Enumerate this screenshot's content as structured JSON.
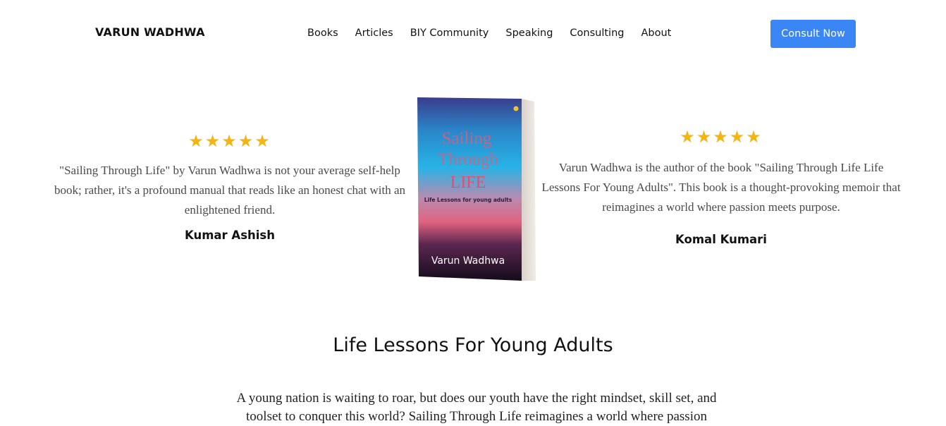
{
  "header": {
    "brand": "VARUN WADHWA",
    "nav": [
      "Books",
      "Articles",
      "BIY Community",
      "Speaking",
      "Consulting",
      "About"
    ],
    "cta_label": "Consult Now"
  },
  "reviews": [
    {
      "stars": "★★★★★",
      "rating": 5,
      "quote": "\"Sailing Through Life\" by Varun Wadhwa is not your average self-help book; rather, it's a profound manual that reads like an honest chat with an enlightened friend.",
      "name": "Kumar Ashish"
    },
    {
      "stars": "★★★★★",
      "rating": 5,
      "quote": "Varun Wadhwa is the author of the book \"Sailing Through Life Life Lessons For Young Adults\". This book is a thought-provoking memoir that reimagines a world where passion meets purpose.",
      "name": "Komal Kumari"
    }
  ],
  "book": {
    "title_line1": "Sailing",
    "title_line2": "Through",
    "title_line3": "LIFE",
    "subtitle": "Life Lessons for young adults",
    "author": "Varun Wadhwa"
  },
  "section": {
    "title": "Life Lessons For Young Adults",
    "body": "A young nation is waiting to roar, but does our youth have the right mindset, skill set, and toolset to conquer this world? Sailing Through Life reimagines a world where passion"
  },
  "colors": {
    "accent": "#3b86f5",
    "star": "#f4b514"
  }
}
